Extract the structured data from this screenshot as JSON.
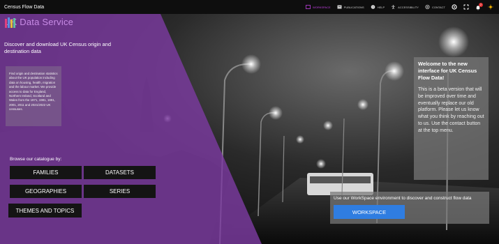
{
  "app": {
    "title": "Census Flow Data"
  },
  "nav": {
    "items": [
      {
        "label": "WORKSPACE",
        "icon": "workspace-icon",
        "active": true
      },
      {
        "label": "PUBLICATIONS",
        "icon": "publications-icon",
        "active": false
      },
      {
        "label": "HELP",
        "icon": "help-icon",
        "active": false
      },
      {
        "label": "ACCESSIBILITY",
        "icon": "accessibility-icon",
        "active": false
      },
      {
        "label": "CONTACT",
        "icon": "contact-icon",
        "active": false
      }
    ],
    "notification_count": "2",
    "accent_color": "#c040e0"
  },
  "hero": {
    "logo_text": "UK Data Service",
    "intro": "Discover and download UK Census origin and destination data",
    "info": "Find origin and destination statistics about the UK population including data on housing, health, migration and the labour market. We provide access to data for England, Northern Ireland, Scotland and Wales from the 1971, 1981, 1991, 2001, 2011 and 2021/2022 UK censuses.",
    "overlay_color": "#7b3aa0"
  },
  "browse": {
    "label": "Browse our catalogue by:",
    "families": "FAMILIES",
    "datasets": "DATASETS",
    "geographies": "GEOGRAPHIES",
    "series": "SERIES",
    "themes": "THEMES AND TOPICS"
  },
  "welcome": {
    "title": "Welcome to the new interface for UK Census Flow Data!",
    "body": "This is a beta version that will be improved over time and eventually replace our old platform. Please let us know what you think by reaching out to us. Use the contact button at the top menu."
  },
  "workspace": {
    "text": "Use our WorkSpace environment to discover and construct flow data",
    "button": "WORKSPACE",
    "button_color": "#2f7de1"
  }
}
